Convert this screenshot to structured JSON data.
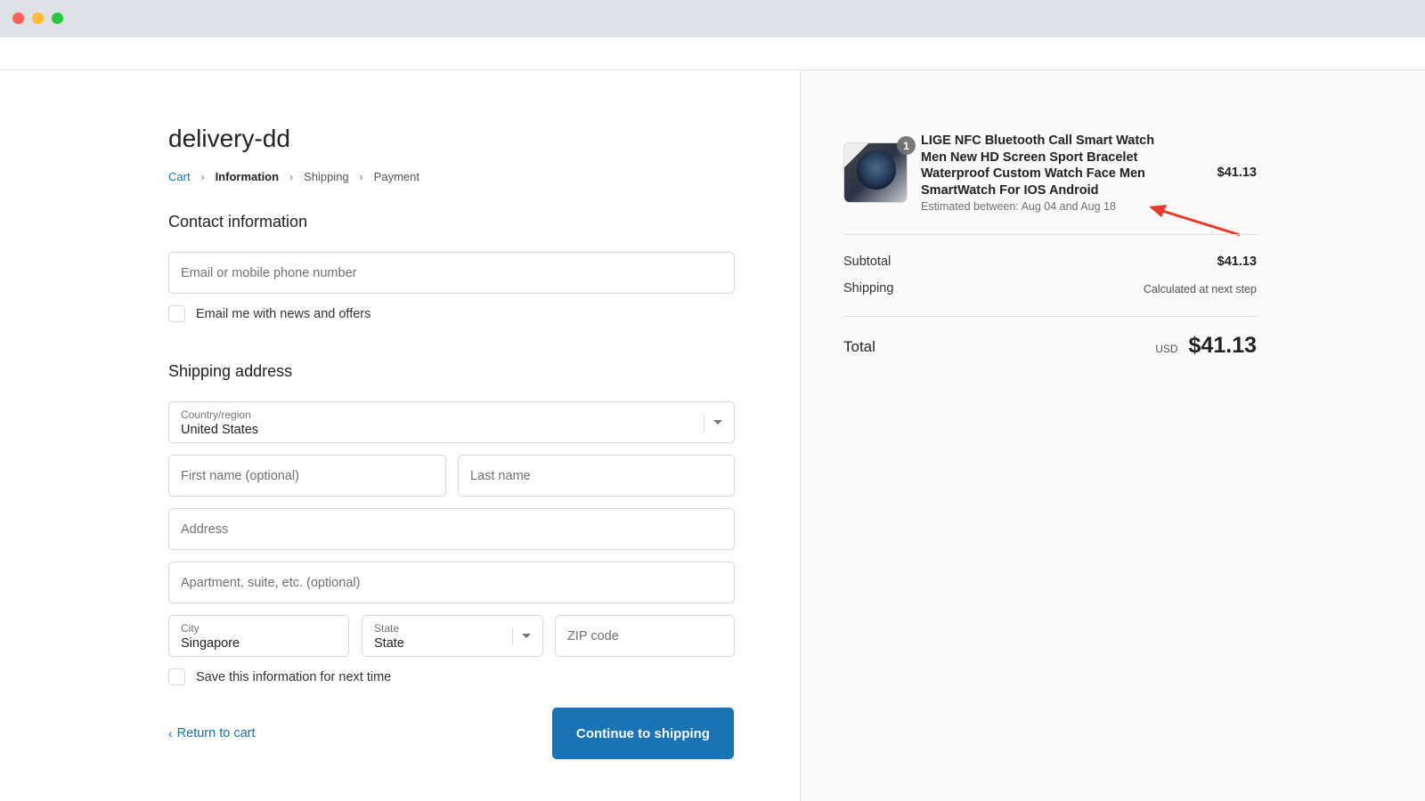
{
  "window": {
    "controls": [
      "close",
      "minimize",
      "maximize"
    ]
  },
  "checkout": {
    "shop_title": "delivery-dd",
    "breadcrumb": [
      {
        "label": "Cart",
        "state": "link"
      },
      {
        "label": "Information",
        "state": "current"
      },
      {
        "label": "Shipping",
        "state": "upcoming"
      },
      {
        "label": "Payment",
        "state": "upcoming"
      }
    ],
    "breadcrumb_separator": "›",
    "contact": {
      "title": "Contact information",
      "email_placeholder": "Email or mobile phone number",
      "email_value": "",
      "newsletter_label": "Email me with news and offers",
      "newsletter_checked": false
    },
    "shipping": {
      "title": "Shipping address",
      "country_label": "Country/region",
      "country_value": "United States",
      "first_name_placeholder": "First name (optional)",
      "last_name_placeholder": "Last name",
      "address_placeholder": "Address",
      "apartment_placeholder": "Apartment, suite, etc. (optional)",
      "city_label": "City",
      "city_value": "Singapore",
      "state_label": "State",
      "state_value": "State",
      "zip_placeholder": "ZIP code",
      "save_info_label": "Save this information for next time",
      "save_info_checked": false
    },
    "actions": {
      "return_label": "Return to cart",
      "continue_label": "Continue to shipping"
    }
  },
  "order_summary": {
    "item": {
      "quantity": "1",
      "name": "LIGE NFC Bluetooth Call Smart Watch Men New HD Screen Sport Bracelet Waterproof Custom Watch Face Men SmartWatch For IOS Android",
      "estimate": "Estimated between: Aug 04 and Aug 18",
      "price": "$41.13",
      "image_icon": "smartwatch-image"
    },
    "subtotal_label": "Subtotal",
    "subtotal_value": "$41.13",
    "shipping_label": "Shipping",
    "shipping_value": "Calculated at next step",
    "total_label": "Total",
    "total_currency": "USD",
    "total_value": "$41.13",
    "annotation": {
      "icon": "red-arrow-icon",
      "color": "#e8392b"
    }
  },
  "colors": {
    "accent": "#1773b0",
    "button": "#1a73b5",
    "sidebar_bg": "#fafafa"
  }
}
